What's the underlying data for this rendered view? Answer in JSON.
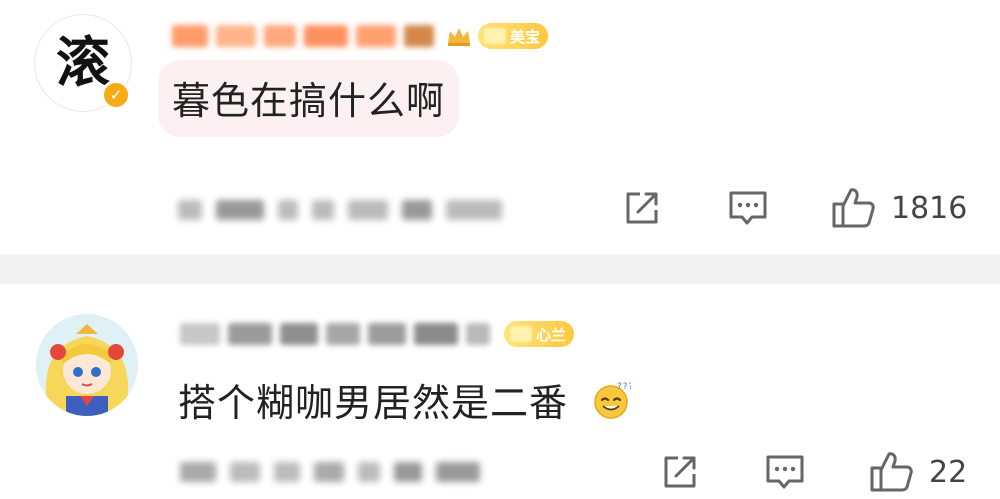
{
  "comments": [
    {
      "avatar_char": "滚",
      "username": "",
      "badge": "美宝",
      "text": "暮色在搞什么啊",
      "likes": "1816",
      "verified": true
    },
    {
      "username": "",
      "badge": "心兰",
      "text": "搭个糊咖男居然是二番",
      "emoji": "sweat-smile-emoji",
      "likes": "22"
    }
  ],
  "colors": {
    "badge_gradient_start": "#ffe27a",
    "badge_gradient_end": "#ffc83c",
    "verified": "#f6ac16",
    "bubble": "#fdf0f2",
    "divider": "#f2f2f2"
  }
}
